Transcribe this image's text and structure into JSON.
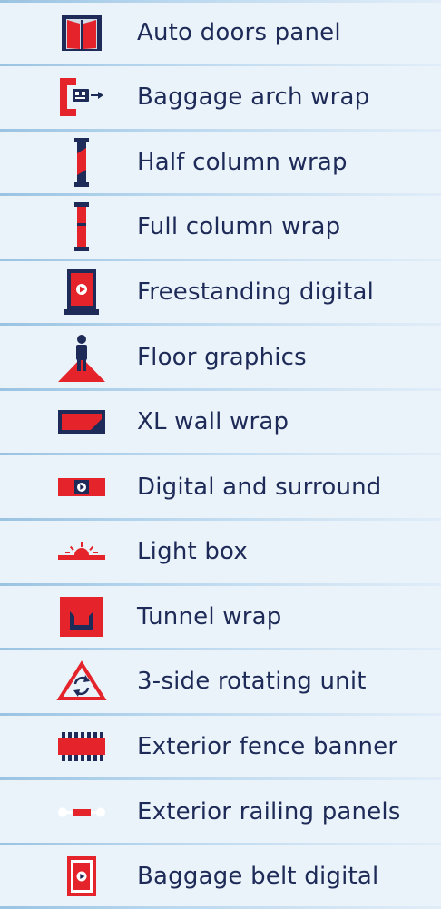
{
  "colors": {
    "navy": "#1e2a57",
    "red": "#e4232b",
    "bg": "#eaf3f9"
  },
  "items": [
    {
      "label": "Auto doors panel",
      "icon": "auto-doors-icon"
    },
    {
      "label": "Baggage arch wrap",
      "icon": "baggage-arch-icon"
    },
    {
      "label": "Half column wrap",
      "icon": "half-column-icon"
    },
    {
      "label": "Full column wrap",
      "icon": "full-column-icon"
    },
    {
      "label": "Freestanding digital",
      "icon": "freestanding-digital-icon"
    },
    {
      "label": "Floor graphics",
      "icon": "floor-graphics-icon"
    },
    {
      "label": "XL wall wrap",
      "icon": "xl-wall-icon"
    },
    {
      "label": "Digital and surround",
      "icon": "digital-surround-icon"
    },
    {
      "label": "Light box",
      "icon": "light-box-icon"
    },
    {
      "label": "Tunnel wrap",
      "icon": "tunnel-wrap-icon"
    },
    {
      "label": "3-side rotating unit",
      "icon": "rotating-unit-icon"
    },
    {
      "label": "Exterior fence banner",
      "icon": "fence-banner-icon"
    },
    {
      "label": "Exterior railing panels",
      "icon": "railing-panels-icon"
    },
    {
      "label": "Baggage belt digital",
      "icon": "baggage-belt-icon"
    }
  ]
}
